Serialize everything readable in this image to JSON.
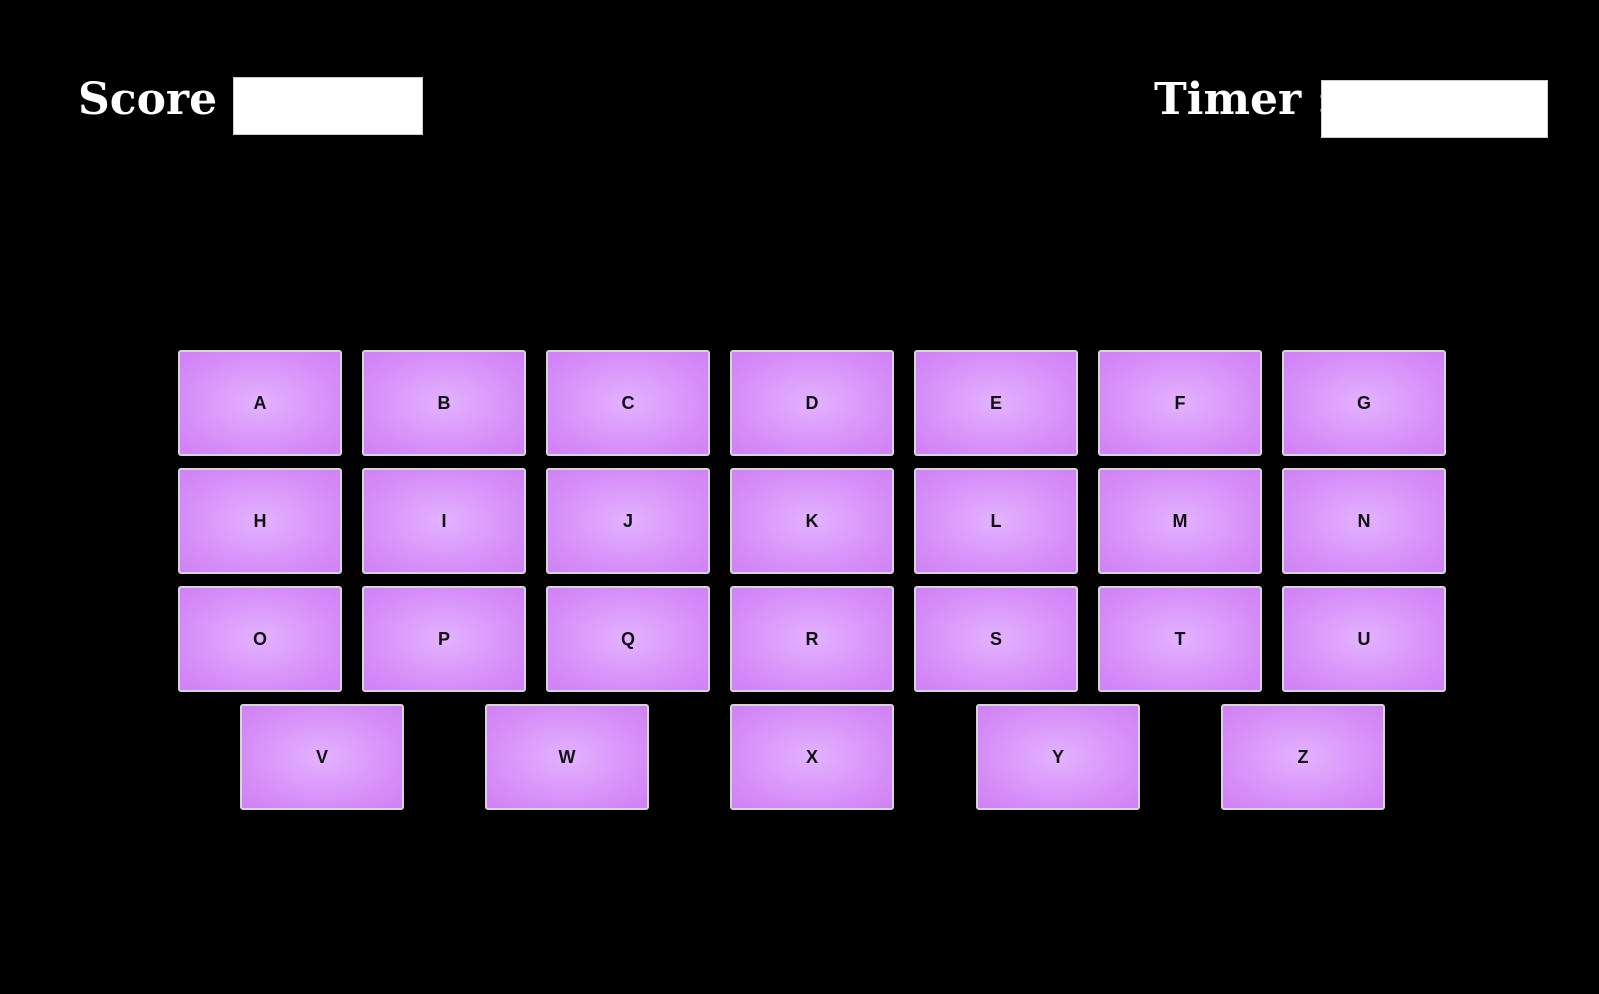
{
  "hud": {
    "score_label": "Score :",
    "score_value": "",
    "timer_label": "Timer :",
    "timer_value": ""
  },
  "colors": {
    "background": "#000000",
    "key_fill": "#d68cf8",
    "key_border": "#d6d6d6",
    "hud_text": "#ffffff"
  },
  "keyboard": {
    "rows": [
      [
        "A",
        "B",
        "C",
        "D",
        "E",
        "F",
        "G"
      ],
      [
        "H",
        "I",
        "J",
        "K",
        "L",
        "M",
        "N"
      ],
      [
        "O",
        "P",
        "Q",
        "R",
        "S",
        "T",
        "U"
      ],
      [
        "V",
        "W",
        "X",
        "Y",
        "Z"
      ]
    ]
  }
}
